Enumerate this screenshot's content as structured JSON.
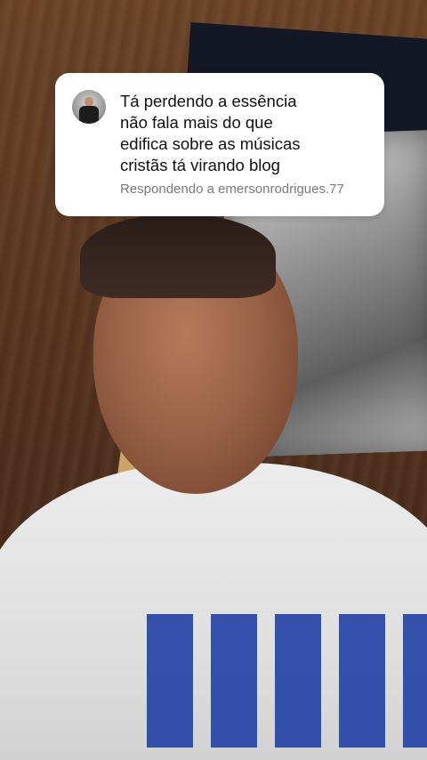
{
  "reply_card": {
    "comment_text": "Tá perdendo a essência\nnão fala mais do que\nedifica sobre as músicas\ncristãs tá virando blog",
    "replying_to": "Respondendo a emersonrodrigues.77"
  },
  "icons": {
    "avatar": "commenter-avatar"
  },
  "colors": {
    "card_bg": "#ffffff",
    "comment_text": "#111111",
    "secondary_text": "#7a7a7a",
    "shirt_print": "#2b48a8"
  }
}
